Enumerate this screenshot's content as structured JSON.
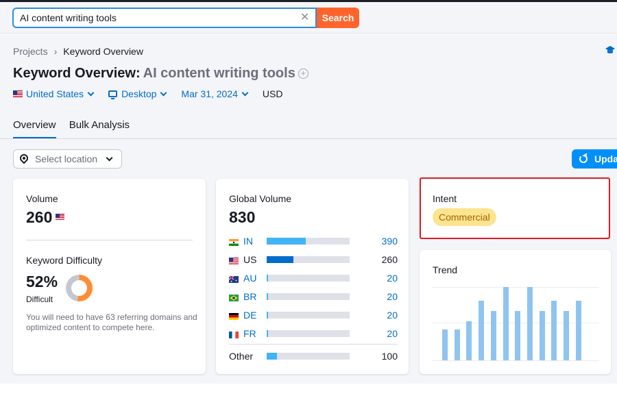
{
  "search": {
    "value": "AI content writing tools",
    "clear_icon": "close-icon",
    "button_label": "Search",
    "button_color": "#ff642d"
  },
  "breadcrumb": {
    "items": [
      "Projects",
      "Keyword Overview"
    ],
    "separator": "›",
    "help_icon": "graduation-cap-icon"
  },
  "header": {
    "title": "Keyword Overview:",
    "keyword": "AI content writing tools",
    "add_icon": "plus-circle-icon"
  },
  "filters": {
    "country": "United States",
    "device": "Desktop",
    "date": "Mar 31, 2024",
    "currency": "USD"
  },
  "tabs": [
    {
      "label": "Overview",
      "active": true
    },
    {
      "label": "Bulk Analysis",
      "active": false
    }
  ],
  "toolbar": {
    "location_placeholder": "Select location",
    "update_label": "Upda"
  },
  "volume": {
    "label": "Volume",
    "value": "260",
    "flag": "us-flag"
  },
  "keyword_difficulty": {
    "label": "Keyword Difficulty",
    "value": "52%",
    "percent": 52,
    "level": "Difficult",
    "note": "You will need to have 63 referring domains and optimized content to compete here.",
    "color": "#ff8c35"
  },
  "global_volume": {
    "label": "Global Volume",
    "value": "830",
    "countries": [
      {
        "flag": "in-flag",
        "code": "IN",
        "value": "390",
        "fraction": 0.47,
        "color": "#41b4f5",
        "link": true
      },
      {
        "flag": "us-flag",
        "code": "US",
        "value": "260",
        "fraction": 0.32,
        "color": "#006dca",
        "link": false
      },
      {
        "flag": "au-flag",
        "code": "AU",
        "value": "20",
        "fraction": 0.02,
        "color": "#41b4f5",
        "link": true
      },
      {
        "flag": "br-flag",
        "code": "BR",
        "value": "20",
        "fraction": 0.02,
        "color": "#41b4f5",
        "link": true
      },
      {
        "flag": "de-flag",
        "code": "DE",
        "value": "20",
        "fraction": 0.02,
        "color": "#41b4f5",
        "link": true
      },
      {
        "flag": "fr-flag",
        "code": "FR",
        "value": "20",
        "fraction": 0.02,
        "color": "#41b4f5",
        "link": true
      }
    ],
    "other": {
      "label": "Other",
      "value": "100",
      "fraction": 0.12,
      "color": "#41b4f5"
    }
  },
  "intent": {
    "label": "Intent",
    "value": "Commercial",
    "badge_color": "#fde58f",
    "highlight_color": "#e01b22"
  },
  "trend": {
    "label": "Trend",
    "bar_color": "#8fc4f0",
    "levels": [
      0.42,
      0.42,
      0.53,
      0.81,
      0.67,
      1.0,
      0.67,
      1.0,
      0.67,
      0.81,
      0.67,
      0.81
    ]
  }
}
